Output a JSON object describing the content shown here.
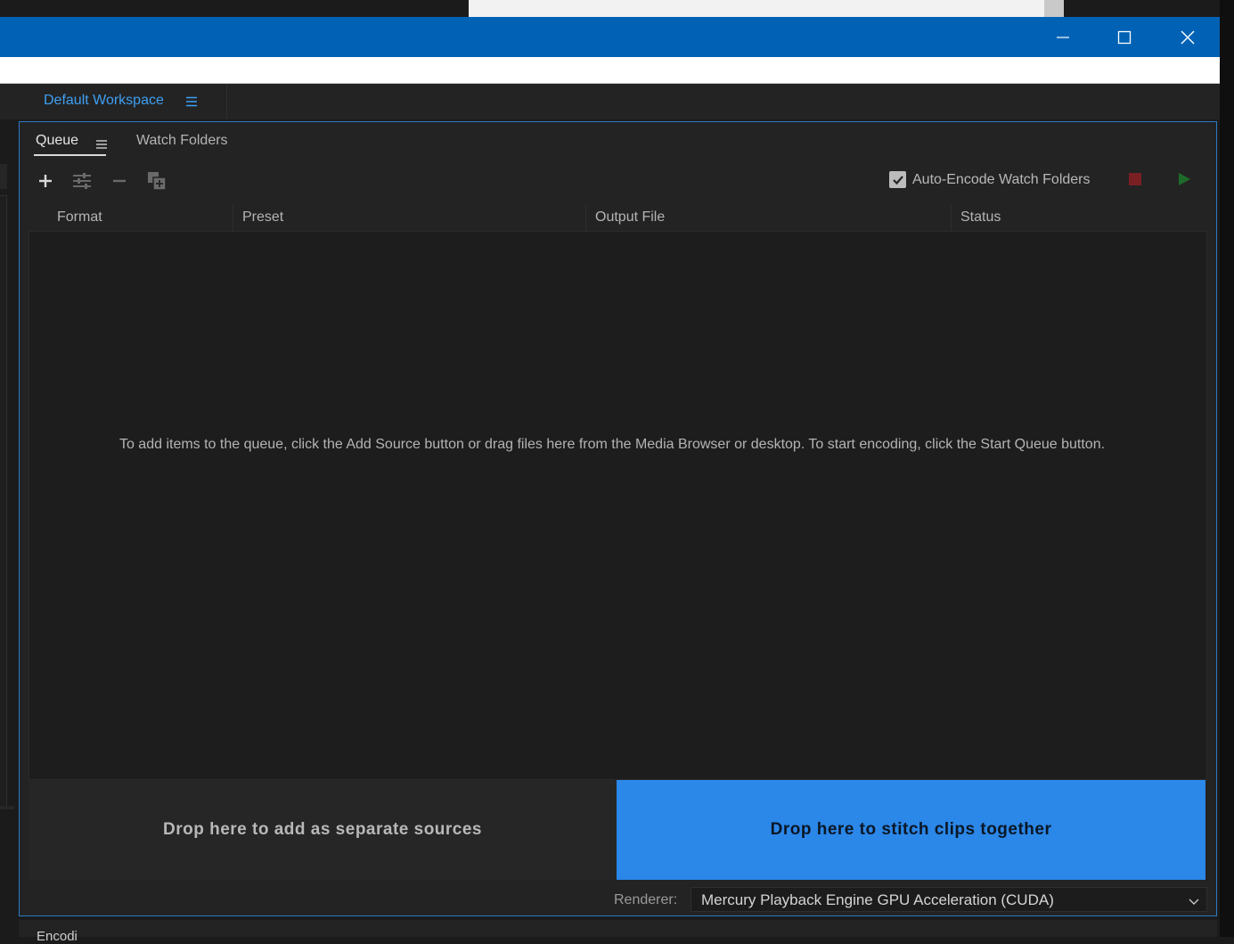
{
  "window": {
    "minimize_icon": "minimize-icon",
    "maximize_icon": "maximize-icon",
    "close_icon": "close-icon",
    "titlebar_color": "#0162b5"
  },
  "workspace": {
    "label": "Default Workspace",
    "menu_icon": "hamburger-menu-icon",
    "accent": "#3e9ff2"
  },
  "tabs": {
    "queue": "Queue",
    "watch_folders": "Watch Folders",
    "queue_menu_icon": "hamburger-menu-icon"
  },
  "toolbar": {
    "add_icon": "plus-icon",
    "settings_icon": "sliders-icon",
    "remove_icon": "minus-icon",
    "duplicate_icon": "duplicate-icon",
    "auto_encode_label": "Auto-Encode Watch Folders",
    "auto_encode_checked": true,
    "stop_icon": "stop-icon",
    "start_icon": "play-icon"
  },
  "columns": [
    "Format",
    "Preset",
    "Output File",
    "Status"
  ],
  "queue": {
    "empty_message": "To add items to the queue, click the Add Source button or drag files here from the Media Browser or desktop.  To start encoding, click the Start Queue button."
  },
  "drop_zones": {
    "separate": "Drop here to add as separate sources",
    "stitch": "Drop here to stitch clips together",
    "stitch_color": "#2b87e8"
  },
  "renderer": {
    "label": "Renderer:",
    "value": "Mercury Playback Engine GPU Acceleration (CUDA)",
    "chevron_icon": "chevron-down-icon"
  },
  "bottom_panel": {
    "title_partial": "Encodi"
  }
}
